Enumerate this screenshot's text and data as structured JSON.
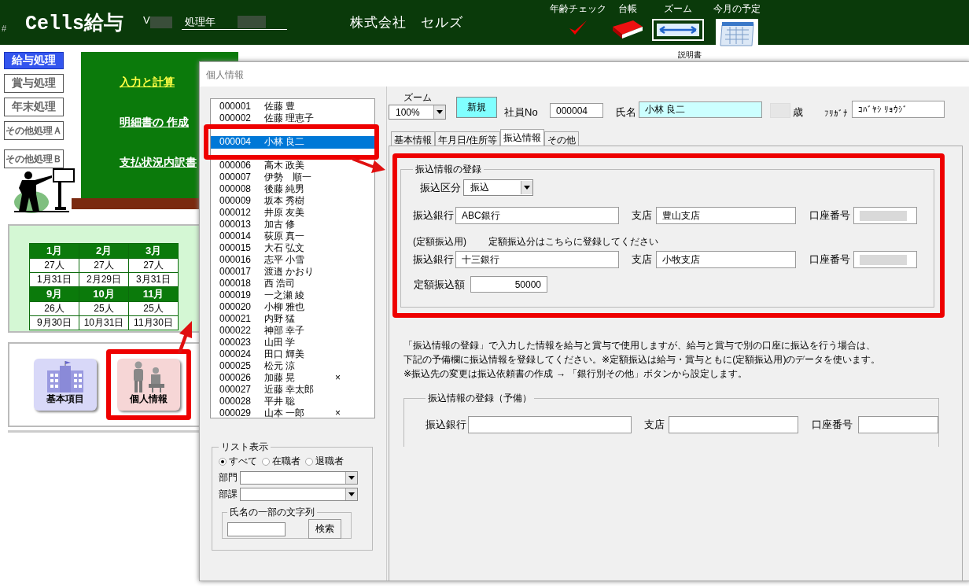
{
  "app_bar": {
    "hash": "#",
    "title": "Cells給与",
    "version_label": "V",
    "year_label": "処理年",
    "company": "株式会社　セルズ",
    "tools": [
      {
        "kind": "check",
        "label": "年齢チェック"
      },
      {
        "kind": "ledger",
        "label": "台帳"
      },
      {
        "kind": "zoom",
        "label": "ズーム"
      },
      {
        "kind": "calendar",
        "label": "今月の予定"
      }
    ]
  },
  "manual_link": "説明書",
  "modes": [
    {
      "label": "給与処理",
      "selected": true
    },
    {
      "label": "賞与処理",
      "selected": false
    },
    {
      "label": "年末処理",
      "selected": false
    },
    {
      "label": "その他処理Ａ",
      "selected": false
    },
    {
      "label": "その他処理Ｂ",
      "selected": false
    }
  ],
  "menu_links": [
    {
      "label": "入力と計算",
      "selected": true
    },
    {
      "label": "明細書の 作成",
      "selected": false
    },
    {
      "label": "支払状況内訳書",
      "selected": false
    }
  ],
  "calendar": [
    {
      "months": [
        "1月",
        "2月",
        "3月"
      ],
      "counts": [
        "27人",
        "27人",
        "27人"
      ],
      "dates": [
        "1月31日",
        "2月29日",
        "3月31日"
      ]
    },
    {
      "months": [
        "9月",
        "10月",
        "11月"
      ],
      "counts": [
        "26人",
        "25人",
        "25人"
      ],
      "dates": [
        "9月30日",
        "10月31日",
        "11月30日"
      ]
    }
  ],
  "shortcuts": [
    {
      "kind": "building",
      "label": "基本項目",
      "highlighted": false
    },
    {
      "kind": "staff",
      "label": "個人情報",
      "highlighted": true
    }
  ],
  "dialog": {
    "title": "個人情報",
    "employees": [
      {
        "code": "000001",
        "name": "佐藤 豊",
        "selected": false
      },
      {
        "code": "000002",
        "name": "佐藤 理恵子",
        "selected": false
      },
      {
        "code": "000004",
        "name": "小林 良二",
        "selected": true
      },
      {
        "code": "000006",
        "name": "高木 政美",
        "selected": false
      },
      {
        "code": "000007",
        "name": "伊勢　順一",
        "selected": false
      },
      {
        "code": "000008",
        "name": "後藤 純男",
        "selected": false
      },
      {
        "code": "000009",
        "name": "坂本 秀樹",
        "selected": false
      },
      {
        "code": "000012",
        "name": "井原 友美",
        "selected": false
      },
      {
        "code": "000013",
        "name": "加古 修",
        "selected": false
      },
      {
        "code": "000014",
        "name": "荻原 真一",
        "selected": false
      },
      {
        "code": "000015",
        "name": "大石 弘文",
        "selected": false
      },
      {
        "code": "000016",
        "name": "志平 小雪",
        "selected": false
      },
      {
        "code": "000017",
        "name": "渡邉 かおり",
        "selected": false
      },
      {
        "code": "000018",
        "name": "西 浩司",
        "selected": false
      },
      {
        "code": "000019",
        "name": "一之瀬 綾",
        "selected": false
      },
      {
        "code": "000020",
        "name": "小柳 雅也",
        "selected": false
      },
      {
        "code": "000021",
        "name": "内野 猛",
        "selected": false
      },
      {
        "code": "000022",
        "name": "神部 幸子",
        "selected": false
      },
      {
        "code": "000023",
        "name": "山田 学",
        "selected": false
      },
      {
        "code": "000024",
        "name": "田口 輝美",
        "selected": false
      },
      {
        "code": "000025",
        "name": "松元 涼",
        "selected": false
      },
      {
        "code": "000026",
        "name": "加藤 晃",
        "mark": "×",
        "selected": false
      },
      {
        "code": "000027",
        "name": "近藤 幸太郎",
        "selected": false
      },
      {
        "code": "000028",
        "name": "平井 聡",
        "selected": false
      },
      {
        "code": "000029",
        "name": "山本 一郎",
        "mark": "×",
        "selected": false
      }
    ],
    "list_filter": {
      "title": "リスト表示",
      "options": [
        {
          "label": "すべて",
          "selected": true
        },
        {
          "label": "在職者",
          "selected": false
        },
        {
          "label": "退職者",
          "selected": false
        }
      ],
      "department_label": "部門",
      "section_label": "部課",
      "search_title": "氏名の一部の文字列",
      "search_button": "検索"
    },
    "header": {
      "zoom_label": "ズーム",
      "zoom_value": "100%",
      "new_button": "新規",
      "employee_no_label": "社員No",
      "employee_no": "000004",
      "name_label": "氏名",
      "name": "小林 良二",
      "age_label": "歳",
      "kana_label": "ﾌﾘｶﾞﾅ",
      "kana": "ｺﾊﾞﾔｼ ﾘｮｳｼﾞ"
    },
    "tabs": [
      {
        "label": "基本情報",
        "selected": false
      },
      {
        "label": "年月日/住所等",
        "selected": false
      },
      {
        "label": "振込情報",
        "selected": true
      },
      {
        "label": "その他",
        "selected": false
      }
    ],
    "transfer": {
      "title": "振込情報の登録",
      "highlighted": true,
      "type_label": "振込区分",
      "type_value": "振込",
      "main": {
        "bank_label": "振込銀行",
        "bank": "ABC銀行",
        "branch_label": "支店",
        "branch": "豊山支店",
        "account_label": "口座番号"
      },
      "fixed_label": "(定額振込用)",
      "fixed_note": "定額振込分はこちらに登録してください",
      "fixed": {
        "bank_label": "振込銀行",
        "bank": "十三銀行",
        "branch_label": "支店",
        "branch": "小牧支店",
        "account_label": "口座番号"
      },
      "amount_label": "定額振込額",
      "amount": "50000"
    },
    "note_lines": [
      "「振込情報の登録」で入力した情報を給与と賞与で使用しますが、給与と賞与で別の口座に振込を行う場合は、",
      "下記の予備欄に振込情報を登録してください。※定額振込は給与・賞与ともに(定額振込用)のデータを使います。",
      "※振込先の変更は振込依頼書の作成 → 「銀行別その他」ボタンから設定します。"
    ],
    "spare": {
      "title": "振込情報の登録（予備）",
      "bank_label": "振込銀行",
      "branch_label": "支店",
      "account_label": "口座番号"
    }
  }
}
